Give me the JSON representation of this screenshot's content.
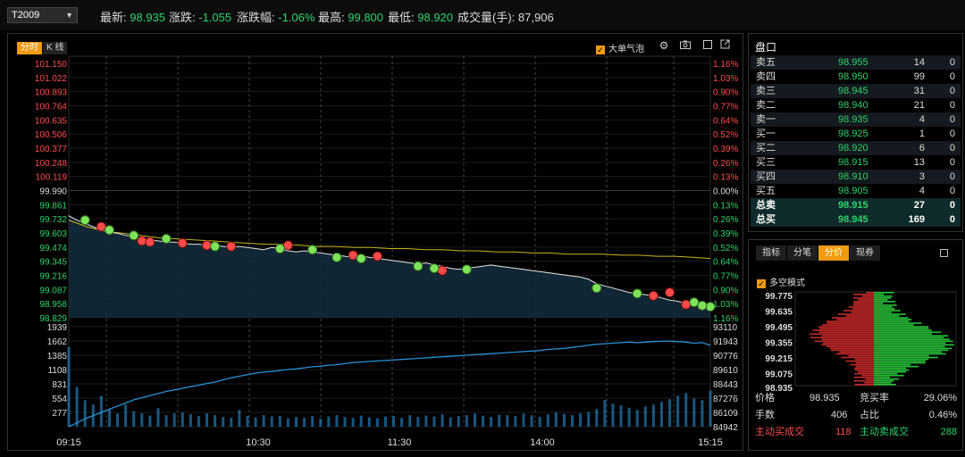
{
  "symbol": "T2009",
  "quote": {
    "last_label": "最新:",
    "last": "98.935",
    "change_label": "涨跌:",
    "change": "-1.055",
    "pct_label": "涨跌幅:",
    "pct": "-1.06%",
    "high_label": "最高:",
    "high": "99.800",
    "low_label": "最低:",
    "low": "98.920",
    "volume_label": "成交量(手):",
    "volume": "87,906"
  },
  "chart_tabs": [
    "分时",
    "K 线"
  ],
  "big_order_label": "大单气泡",
  "toolbar_icons": [
    "gear-icon",
    "camera-icon",
    "square-icon",
    "export-icon"
  ],
  "colors": {
    "up": "#ff4d4d",
    "down": "#2bd56b",
    "accent": "#f09a12",
    "avg": "#c9b51a",
    "price": "#e6e6e6",
    "volume": "#2a8fd6"
  },
  "chart_data": {
    "type": "line",
    "price_ticks_up": [
      "101.150",
      "101.022",
      "100.893",
      "100.764",
      "100.635",
      "100.506",
      "100.377",
      "100.248",
      "100.119"
    ],
    "price_tick_base": "99.990",
    "price_ticks_down": [
      "99.861",
      "99.732",
      "99.603",
      "99.474",
      "99.345",
      "99.216",
      "99.087",
      "98.958",
      "98.829"
    ],
    "pct_ticks_up": [
      "1.16%",
      "1.03%",
      "0.90%",
      "0.77%",
      "0.64%",
      "0.52%",
      "0.39%",
      "0.26%",
      "0.13%"
    ],
    "pct_tick_base": "0.00%",
    "pct_ticks_down": [
      "0.13%",
      "0.26%",
      "0.39%",
      "0.52%",
      "0.64%",
      "0.77%",
      "0.90%",
      "1.03%",
      "1.16%"
    ],
    "volume_ticks": [
      "1939",
      "1662",
      "1385",
      "1108",
      "831",
      "554",
      "277"
    ],
    "oi_ticks": [
      "93110",
      "91943",
      "90776",
      "89610",
      "88443",
      "87276",
      "86109",
      "84942"
    ],
    "time_ticks": [
      "09:15",
      "10:30",
      "11:30",
      "14:00",
      "15:15"
    ],
    "price_range": [
      98.829,
      101.15
    ],
    "price": [
      99.76,
      99.72,
      99.69,
      99.66,
      99.63,
      99.61,
      99.6,
      99.58,
      99.57,
      99.55,
      99.54,
      99.53,
      99.52,
      99.52,
      99.51,
      99.5,
      99.5,
      99.49,
      99.49,
      99.48,
      99.47,
      99.48,
      99.47,
      99.46,
      99.45,
      99.47,
      99.46,
      99.44,
      99.43,
      99.44,
      99.43,
      99.42,
      99.41,
      99.4,
      99.39,
      99.38,
      99.39,
      99.38,
      99.37,
      99.36,
      99.35,
      99.34,
      99.33,
      99.32,
      99.33,
      99.31,
      99.3,
      99.28,
      99.27,
      99.28,
      99.29,
      99.3,
      99.31,
      99.3,
      99.29,
      99.28,
      99.27,
      99.26,
      99.25,
      99.24,
      99.23,
      99.22,
      99.21,
      99.2,
      99.18,
      99.14,
      99.12,
      99.1,
      99.08,
      99.06,
      99.05,
      99.04,
      99.03,
      99.01,
      98.99,
      98.98,
      98.96,
      98.95,
      98.94,
      98.935
    ],
    "avg_price": [
      99.72,
      99.66,
      99.62,
      99.6,
      99.58,
      99.56,
      99.55,
      99.54,
      99.53,
      99.52,
      99.51,
      99.5,
      99.5,
      99.49,
      99.48,
      99.48,
      99.47,
      99.47,
      99.46,
      99.46,
      99.45,
      99.45,
      99.44,
      99.44,
      99.43,
      99.43,
      99.42,
      99.42,
      99.41,
      99.41,
      99.41,
      99.4,
      99.4,
      99.39,
      99.39,
      99.38,
      99.37
    ],
    "bubbles_buy": [
      [
        2,
        99.72
      ],
      [
        5,
        99.63
      ],
      [
        8,
        99.58
      ],
      [
        12,
        99.55
      ],
      [
        18,
        99.48
      ],
      [
        26,
        99.46
      ],
      [
        30,
        99.45
      ],
      [
        33,
        99.38
      ],
      [
        36,
        99.37
      ],
      [
        43,
        99.3
      ],
      [
        45,
        99.28
      ],
      [
        49,
        99.27
      ],
      [
        65,
        99.1
      ],
      [
        70,
        99.05
      ],
      [
        77,
        98.97
      ],
      [
        79,
        98.93
      ],
      [
        78,
        98.94
      ]
    ],
    "bubbles_sell": [
      [
        4,
        99.66
      ],
      [
        9,
        99.53
      ],
      [
        10,
        99.52
      ],
      [
        14,
        99.51
      ],
      [
        17,
        99.49
      ],
      [
        20,
        99.48
      ],
      [
        27,
        99.49
      ],
      [
        35,
        99.4
      ],
      [
        38,
        99.39
      ],
      [
        46,
        99.26
      ],
      [
        72,
        99.03
      ],
      [
        74,
        99.06
      ],
      [
        76,
        98.95
      ],
      [
        78,
        98.94
      ]
    ],
    "open_interest": [
      84942,
      85300,
      85700,
      86000,
      86300,
      86600,
      86900,
      87200,
      87500,
      87700,
      87900,
      88100,
      88300,
      88450,
      88600,
      88750,
      88900,
      89050,
      89200,
      89400,
      89600,
      89750,
      89900,
      90050,
      90150,
      90200,
      90300,
      90400,
      90450,
      90550,
      90650,
      90700,
      90800,
      90850,
      90950,
      91050,
      91100,
      91150,
      91200,
      91250,
      91300,
      91350,
      91400,
      91450,
      91500,
      91550,
      91600,
      91650,
      91700,
      91750,
      91800,
      91850,
      91900,
      91950,
      92000,
      92050,
      92100,
      92150,
      92200,
      92300,
      92350,
      92400,
      92500,
      92600,
      92700,
      92800,
      92850,
      92900,
      92950,
      93000,
      92950,
      93000,
      93050,
      93080,
      93100,
      93050,
      93000,
      92900,
      92950,
      92700
    ],
    "volume": [
      1800,
      900,
      600,
      500,
      700,
      400,
      300,
      500,
      350,
      300,
      250,
      420,
      260,
      300,
      320,
      280,
      240,
      300,
      260,
      220,
      200,
      380,
      240,
      210,
      260,
      230,
      250,
      190,
      220,
      200,
      240,
      180,
      230,
      260,
      220,
      200,
      250,
      210,
      190,
      230,
      240,
      200,
      260,
      220,
      250,
      230,
      280,
      210,
      240,
      260,
      300,
      250,
      220,
      270,
      260,
      240,
      300,
      260,
      220,
      280,
      320,
      290,
      260,
      300,
      330,
      400,
      600,
      520,
      480,
      430,
      380,
      460,
      500,
      560,
      620,
      700,
      760,
      640,
      600,
      820
    ]
  },
  "order_book": {
    "title": "盘口",
    "rows": [
      {
        "name": "卖五",
        "price": "98.955",
        "vol": "14",
        "chg": "0"
      },
      {
        "name": "卖四",
        "price": "98.950",
        "vol": "99",
        "chg": "0"
      },
      {
        "name": "卖三",
        "price": "98.945",
        "vol": "31",
        "chg": "0"
      },
      {
        "name": "卖二",
        "price": "98.940",
        "vol": "21",
        "chg": "0"
      },
      {
        "name": "卖一",
        "price": "98.935",
        "vol": "4",
        "chg": "0"
      },
      {
        "name": "买一",
        "price": "98.925",
        "vol": "1",
        "chg": "0"
      },
      {
        "name": "买二",
        "price": "98.920",
        "vol": "6",
        "chg": "0"
      },
      {
        "name": "买三",
        "price": "98.915",
        "vol": "13",
        "chg": "0"
      },
      {
        "name": "买四",
        "price": "98.910",
        "vol": "3",
        "chg": "0"
      },
      {
        "name": "买五",
        "price": "98.905",
        "vol": "4",
        "chg": "0"
      }
    ],
    "totals": [
      {
        "name": "总卖",
        "price": "98.915",
        "vol": "27",
        "chg": "0"
      },
      {
        "name": "总买",
        "price": "98.945",
        "vol": "169",
        "chg": "0"
      }
    ]
  },
  "distribution": {
    "tabs": [
      "指标",
      "分笔",
      "分价",
      "现券"
    ],
    "active_tab": 2,
    "mode_label": "多空模式",
    "price_ticks": [
      "99.775",
      "99.635",
      "99.495",
      "99.355",
      "99.215",
      "99.075",
      "98.935"
    ],
    "stats": {
      "price_label": "价格",
      "price": "98.935",
      "bid_ratio_label": "竞买率",
      "bid_ratio": "29.06%",
      "lots_label": "手数",
      "lots": "406",
      "share_label": "占比",
      "share": "0.46%",
      "active_buy_label": "主动买成交",
      "active_buy": "118",
      "active_sell_label": "主动卖成交",
      "active_sell": "288"
    }
  }
}
